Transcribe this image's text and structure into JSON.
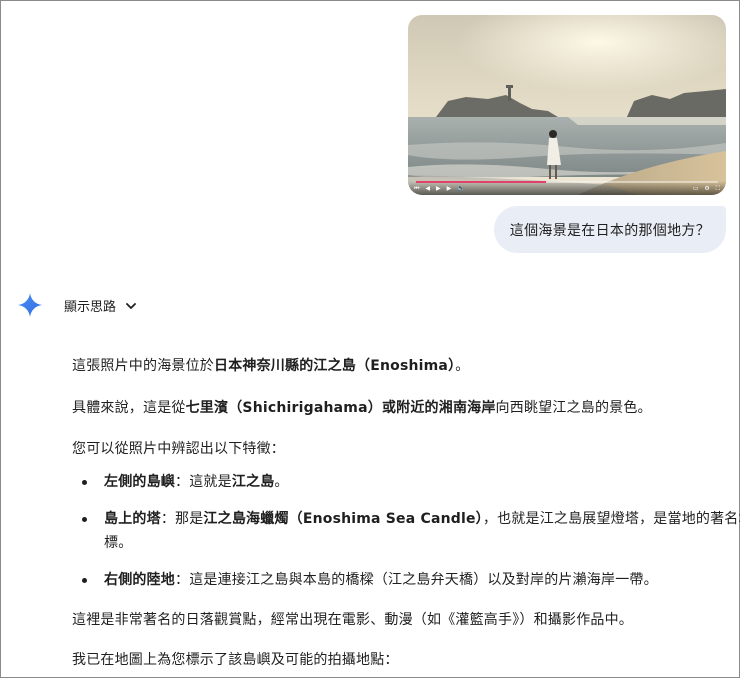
{
  "user_image": {
    "progress_fraction": 0.43
  },
  "user_message": "這個海景是在日本的那個地方？",
  "thoughts_toggle": {
    "label": "顯示思路"
  },
  "response": {
    "p1": {
      "t1": "這張照片中的海景位於",
      "b1": "日本神奈川縣的江之島（Enoshima）",
      "t2": "。"
    },
    "p2": {
      "t1": "具體來說，這是從",
      "b1": "七里濱（Shichirigahama）或附近的湘南海岸",
      "t2": "向西眺望江之島的景色。"
    },
    "p3": "您可以從照片中辨認出以下特徵：",
    "bullets": [
      {
        "label": "左側的島嶼",
        "sep": "：這就是",
        "bold2": "江之島",
        "rest": "。"
      },
      {
        "label": "島上的塔",
        "sep": "：那是",
        "bold2": "江之島海蠟燭（Enoshima Sea Candle）",
        "rest": "，也就是江之島展望燈塔，是當地的著名地標。"
      },
      {
        "label": "右側的陸地",
        "sep": "：這是連接江之島與本島的橋樑（江之島弁天橋）以及對岸的片瀨海岸一帶。",
        "bold2": "",
        "rest": ""
      }
    ],
    "p4": "這裡是非常著名的日落觀賞點，經常出現在電影、動漫（如《灌籃高手》）和攝影作品中。",
    "p5": "我已在地圖上為您標示了該島嶼及可能的拍攝地點："
  },
  "colors": {
    "bubble_bg": "#e9eef6",
    "gemini_blue": "#4285f4",
    "text": "#1f1f1f"
  }
}
